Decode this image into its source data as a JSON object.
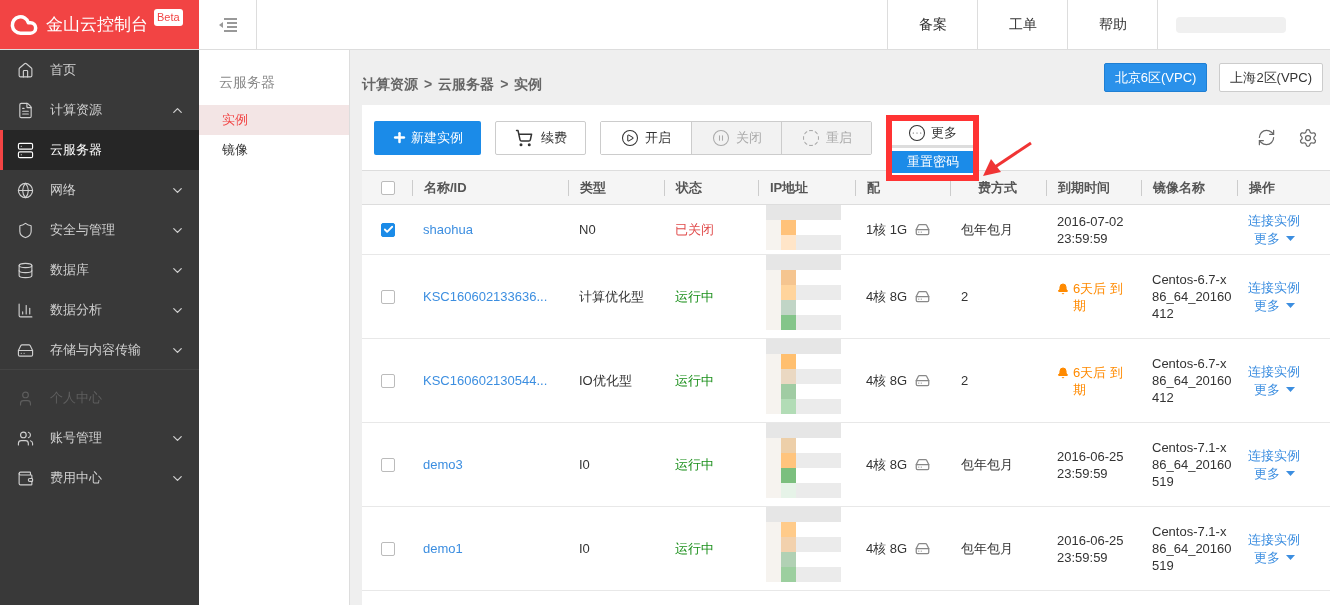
{
  "brand": {
    "title": "金山云控制台",
    "badge": "Beta"
  },
  "header_links": [
    "备案",
    "工单",
    "帮助"
  ],
  "sidebar": {
    "items": [
      {
        "label": "首页",
        "selected": false,
        "disabled": false
      },
      {
        "label": "计算资源",
        "selected": false,
        "disabled": false,
        "expanded": true
      },
      {
        "label": "云服务器",
        "selected": true,
        "disabled": false
      },
      {
        "label": "网络",
        "selected": false,
        "disabled": false,
        "expanded": false
      },
      {
        "label": "安全与管理",
        "selected": false,
        "disabled": false,
        "expanded": false
      },
      {
        "label": "数据库",
        "selected": false,
        "disabled": false,
        "expanded": false
      },
      {
        "label": "数据分析",
        "selected": false,
        "disabled": false,
        "expanded": false
      },
      {
        "label": "存储与内容传输",
        "selected": false,
        "disabled": false,
        "expanded": false
      },
      {
        "label": "个人中心",
        "selected": false,
        "disabled": true
      },
      {
        "label": "账号管理",
        "selected": false,
        "disabled": false,
        "expanded": false
      },
      {
        "label": "费用中心",
        "selected": false,
        "disabled": false,
        "expanded": false
      }
    ]
  },
  "subnav": {
    "title": "云服务器",
    "items": [
      {
        "label": "实例",
        "selected": true
      },
      {
        "label": "镜像",
        "selected": false
      }
    ]
  },
  "breadcrumb": {
    "items": [
      "计算资源",
      "云服务器",
      "实例"
    ],
    "separator": ">"
  },
  "regions": [
    {
      "label": "北京6区(VPC)",
      "selected": true
    },
    {
      "label": "上海2区(VPC)",
      "selected": false
    }
  ],
  "toolbar": {
    "create": "新建实例",
    "renew": "续费",
    "actions": [
      {
        "label": "开启",
        "disabled": false
      },
      {
        "label": "关闭",
        "disabled": true
      },
      {
        "label": "重启",
        "disabled": true
      }
    ],
    "more": {
      "label": "更多",
      "menu": [
        "重置密码"
      ]
    }
  },
  "table": {
    "select_all_checked": false,
    "columns": [
      "名称/ID",
      "类型",
      "状态",
      "IP地址",
      "配",
      "费方式",
      "到期时间",
      "镜像名称",
      "操作"
    ],
    "rows": [
      {
        "checked": true,
        "name": "shaohua",
        "type": "N0",
        "status": {
          "text": "已关闭",
          "kind": "stopped"
        },
        "config": "1核 1G",
        "pay": "包年包月",
        "expire": {
          "text": "2016-07-02 23:59:59",
          "kind": "date"
        },
        "actions": [
          "连接实例",
          "更多"
        ]
      },
      {
        "checked": false,
        "name": "KSC160602133636...",
        "type": "计算优化型",
        "status": {
          "text": "运行中",
          "kind": "running"
        },
        "config": "4核 8G",
        "pay": "2",
        "expire": {
          "text": "6天后 到期",
          "kind": "warning"
        },
        "image": "Centos-6.7-x86_64_20160412",
        "actions": [
          "连接实例",
          "更多"
        ]
      },
      {
        "checked": false,
        "name": "KSC160602130544...",
        "type": "IO优化型",
        "status": {
          "text": "运行中",
          "kind": "running"
        },
        "config": "4核 8G",
        "pay": "2",
        "expire": {
          "text": "6天后 到期",
          "kind": "warning"
        },
        "image": "Centos-6.7-x86_64_20160412",
        "actions": [
          "连接实例",
          "更多"
        ]
      },
      {
        "checked": false,
        "name": "demo3",
        "type": "I0",
        "status": {
          "text": "运行中",
          "kind": "running"
        },
        "config": "4核 8G",
        "pay": "包年包月",
        "expire": {
          "text": "2016-06-25 23:59:59",
          "kind": "date"
        },
        "image": "Centos-7.1-x86_64_20160519",
        "actions": [
          "连接实例",
          "更多"
        ]
      },
      {
        "checked": false,
        "name": "demo1",
        "type": "I0",
        "status": {
          "text": "运行中",
          "kind": "running"
        },
        "config": "4核 8G",
        "pay": "包年包月",
        "expire": {
          "text": "2016-06-25 23:59:59",
          "kind": "date"
        },
        "image": "Centos-7.1-x86_64_20160519",
        "actions": [
          "连接实例",
          "更多"
        ]
      }
    ]
  }
}
